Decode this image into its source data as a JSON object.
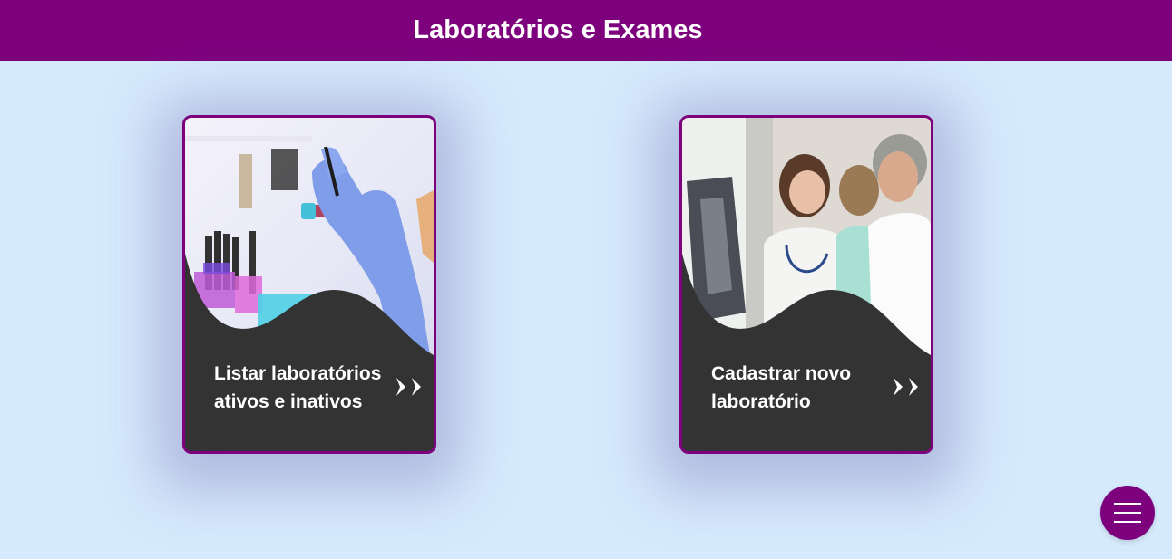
{
  "header": {
    "title": "Laboratórios e Exames"
  },
  "cards": [
    {
      "label": "Listar laboratórios ativos e inativos",
      "image": "lab-gloved-hand-test-tube-photo",
      "icon": "double-chevron-right-icon"
    },
    {
      "label": "Cadastrar novo laboratório",
      "image": "doctors-reviewing-xray-photo",
      "icon": "double-chevron-right-icon"
    }
  ],
  "fab": {
    "icon": "hamburger-menu-icon"
  },
  "colors": {
    "primary": "#7d007d",
    "background": "#d6eafd",
    "card": "#333333",
    "text_light": "#ffffff"
  }
}
